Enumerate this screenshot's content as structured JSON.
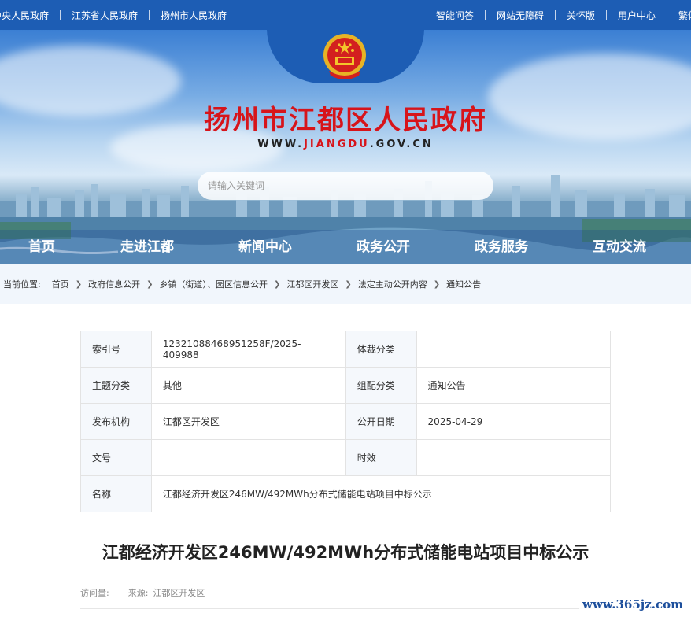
{
  "topbar": {
    "left_links": [
      "中央人民政府",
      "江苏省人民政府",
      "扬州市人民政府"
    ],
    "right_links": [
      "智能问答",
      "网站无障碍",
      "关怀版",
      "用户中心",
      "繁体"
    ]
  },
  "header": {
    "title": "扬州市江都区人民政府",
    "url_prefix": "WWW.",
    "url_highlight": "JIANGDU",
    "url_suffix": ".GOV.CN",
    "emblem": "national-emblem-icon"
  },
  "search": {
    "placeholder": "请输入关键词"
  },
  "nav": {
    "items": [
      "首页",
      "走进江都",
      "新闻中心",
      "政务公开",
      "政务服务",
      "互动交流"
    ]
  },
  "breadcrumb": {
    "label": "当前位置:",
    "items": [
      "首页",
      "政府信息公开",
      "乡镇（街道）、园区信息公开",
      "江都区开发区",
      "法定主动公开内容",
      "通知公告"
    ]
  },
  "info_table": {
    "index_label": "索引号",
    "index_value": "12321088468951258F/2025-409988",
    "genre_label": "体裁分类",
    "genre_value": "",
    "topic_label": "主题分类",
    "topic_value": "其他",
    "group_label": "组配分类",
    "group_value": "通知公告",
    "publisher_label": "发布机构",
    "publisher_value": "江都区开发区",
    "date_label": "公开日期",
    "date_value": "2025-04-29",
    "docno_label": "文号",
    "docno_value": "",
    "validity_label": "时效",
    "validity_value": "",
    "name_label": "名称",
    "name_value": "江都经济开发区246MW/492MWh分布式储能电站项目中标公示"
  },
  "article": {
    "title": "江都经济开发区246MW/492MWh分布式储能电站项目中标公示",
    "views_label": "访问量:",
    "source_label": "来源:",
    "source_value": "江都区开发区"
  },
  "watermark": "www.365jz.com",
  "colors": {
    "brand_blue": "#1d5db4",
    "title_red": "#d7141a"
  }
}
